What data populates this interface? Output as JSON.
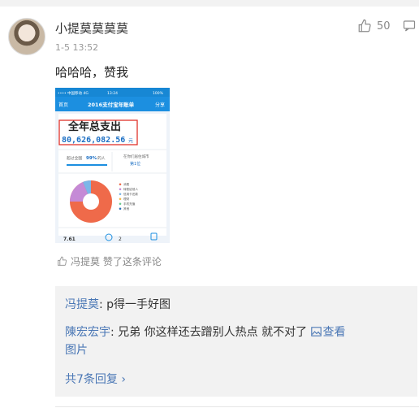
{
  "comment": {
    "username": "小提莫莫莫莫",
    "time": "1-5 13:52",
    "text": "哈哈哈，赞我",
    "like_count": "50"
  },
  "screenshot": {
    "status_left": "•••• 中国移动 4G",
    "status_time": "13:24",
    "status_right": "100%",
    "nav_back": "首页",
    "nav_title": "2016支付宝年账单",
    "nav_share": "分享",
    "total_label": "全年总支出",
    "total_amount": "80,626,082.56",
    "total_unit": "元",
    "beat_label": "超过全国",
    "beat_value": "99%",
    "beat_suffix": "的人",
    "rank_label": "在你们居住城市",
    "rank_value": "第1位",
    "legend": [
      "消费",
      "转账给他人",
      "信用卡还款",
      "理财",
      "手机充值",
      "其他"
    ],
    "bottom_left": "7.61",
    "bottom_right": "2"
  },
  "liked_by": "冯提莫 赞了这条评论",
  "replies": [
    {
      "user": "冯提莫",
      "text": ": p得一手好图"
    },
    {
      "user": "陳宏宏宇",
      "text": ": 兄弟 你这样还去蹭别人热点 就不对了 ",
      "link": "查看",
      "wrap": "图片"
    }
  ],
  "more_replies": "共7条回复 ›",
  "colors": {
    "link": "#4a77b5",
    "highlight_box": "#e0332b"
  }
}
